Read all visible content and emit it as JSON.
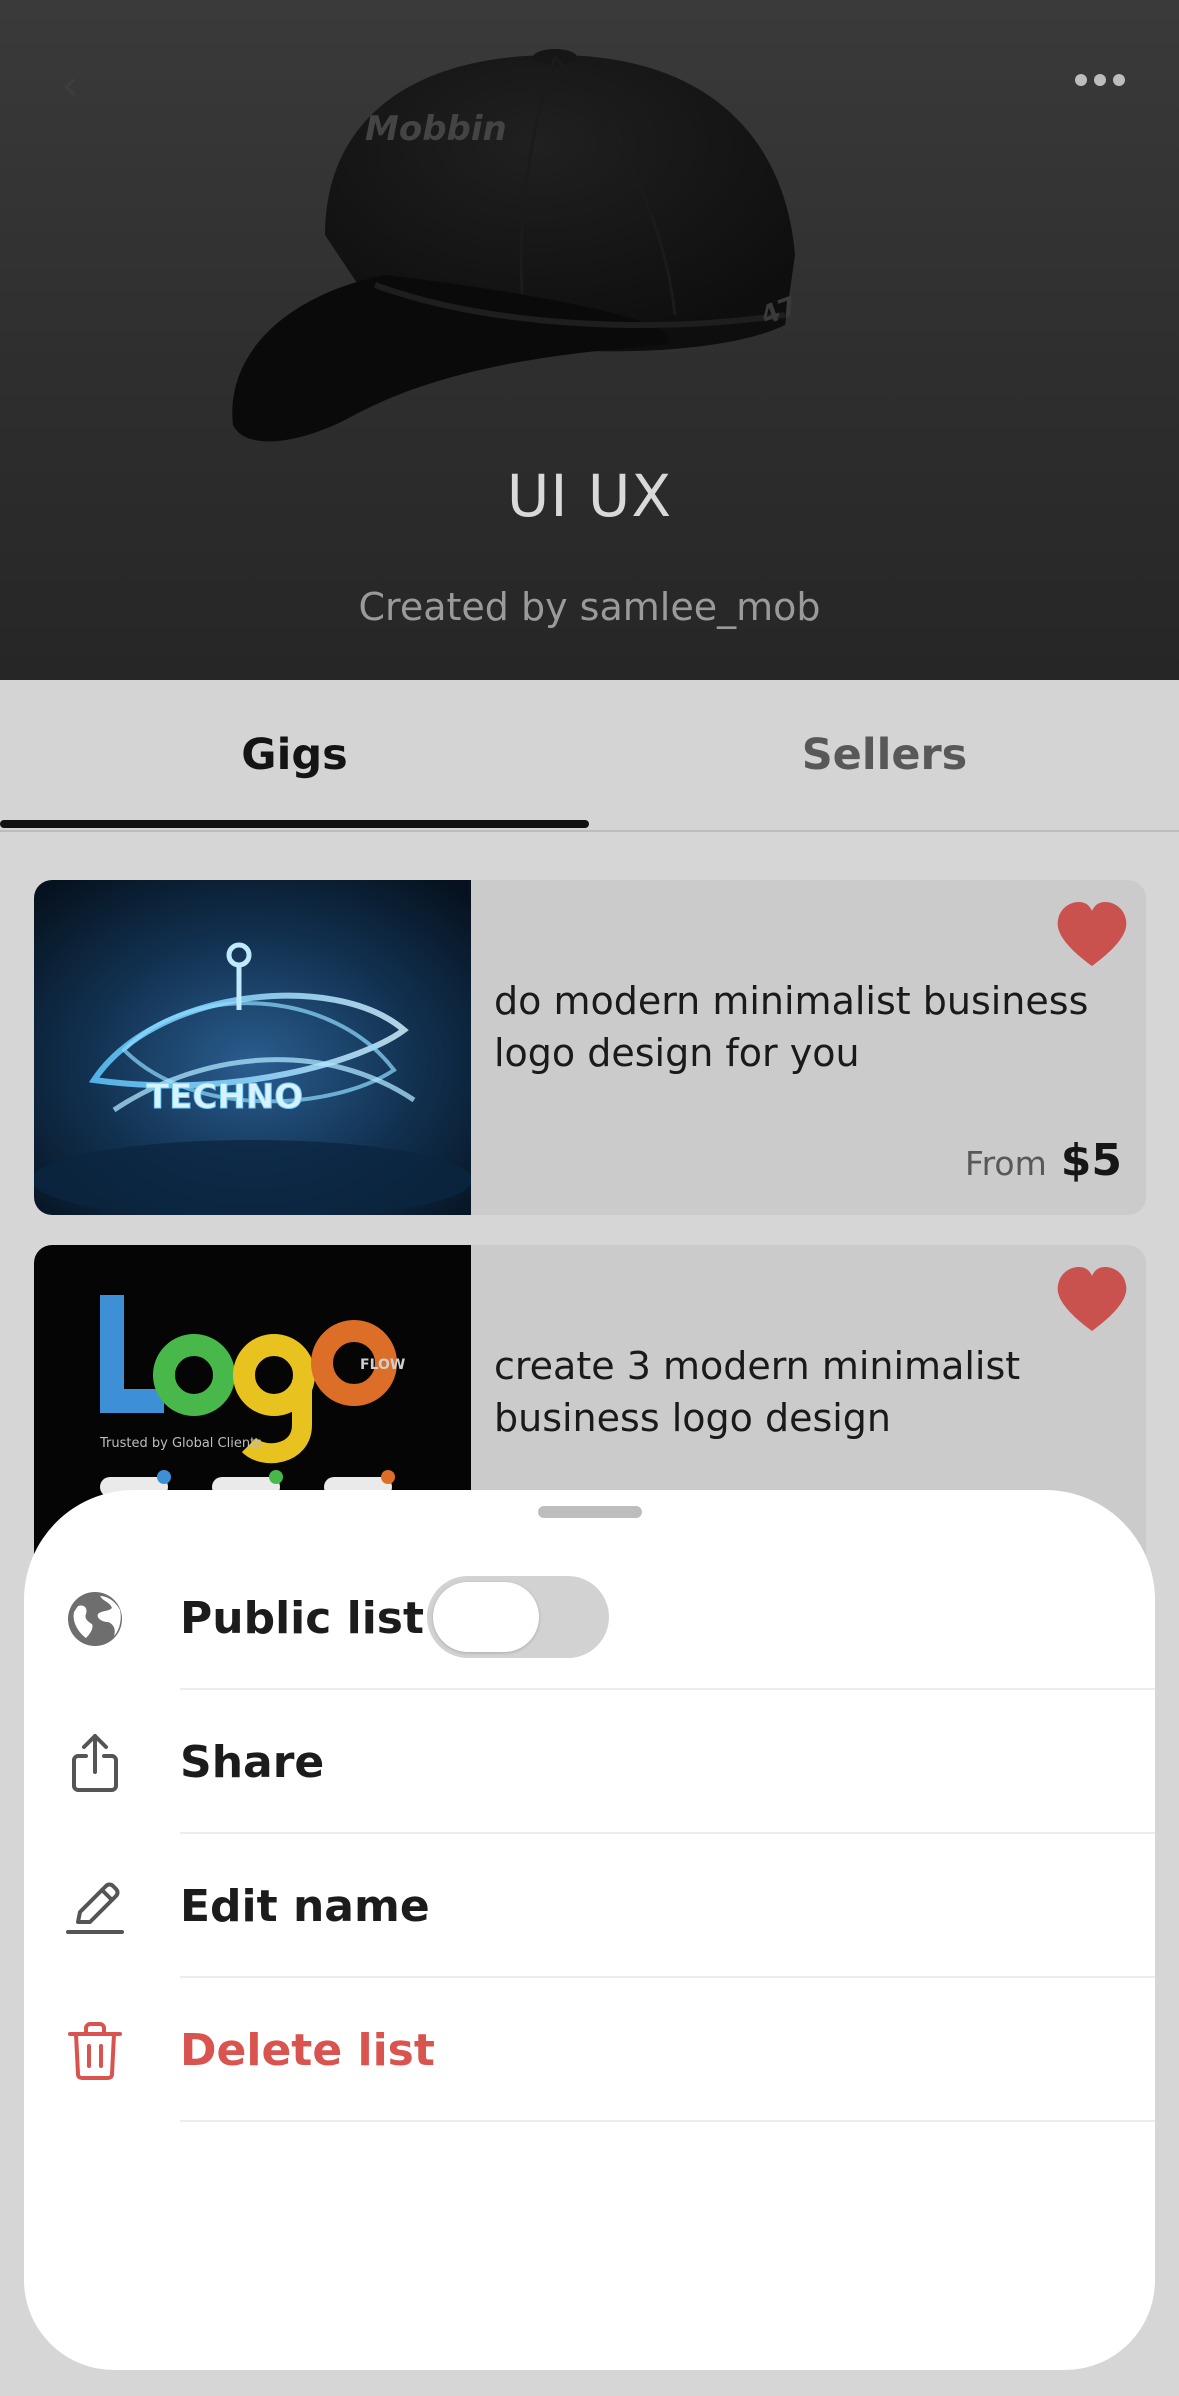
{
  "header": {
    "title": "UI UX",
    "created_by": "Created by samlee_mob",
    "cap_brand_text": "Mobbin",
    "back_icon": "chevron-left-icon",
    "more_icon": "more-horizontal-icon"
  },
  "tabs": [
    {
      "label": "Gigs",
      "selected": true
    },
    {
      "label": "Sellers",
      "selected": false
    }
  ],
  "gigs": [
    {
      "title": "do modern minimalist business logo design for you",
      "price_prefix": "From",
      "price": "$5",
      "favorited": true,
      "thumb_text": "TECHNO"
    },
    {
      "title": "create 3 modern minimalist business logo design",
      "favorited": true,
      "thumb_text": "Logo",
      "thumb_subtext": "FLOW",
      "thumb_caption": "Trusted by Global Clients"
    }
  ],
  "sheet": {
    "items": [
      {
        "label": "Public list",
        "icon": "globe-icon",
        "toggle_on": false
      },
      {
        "label": "Share",
        "icon": "share-icon"
      },
      {
        "label": "Edit name",
        "icon": "pencil-icon"
      },
      {
        "label": "Delete list",
        "icon": "trash-icon",
        "destructive": true
      }
    ]
  },
  "colors": {
    "heart": "#c9524e",
    "danger": "#d9534f",
    "header_bg": "#2e2e2e",
    "page_bg": "#d6d6d6",
    "sheet_bg": "#ffffff"
  }
}
